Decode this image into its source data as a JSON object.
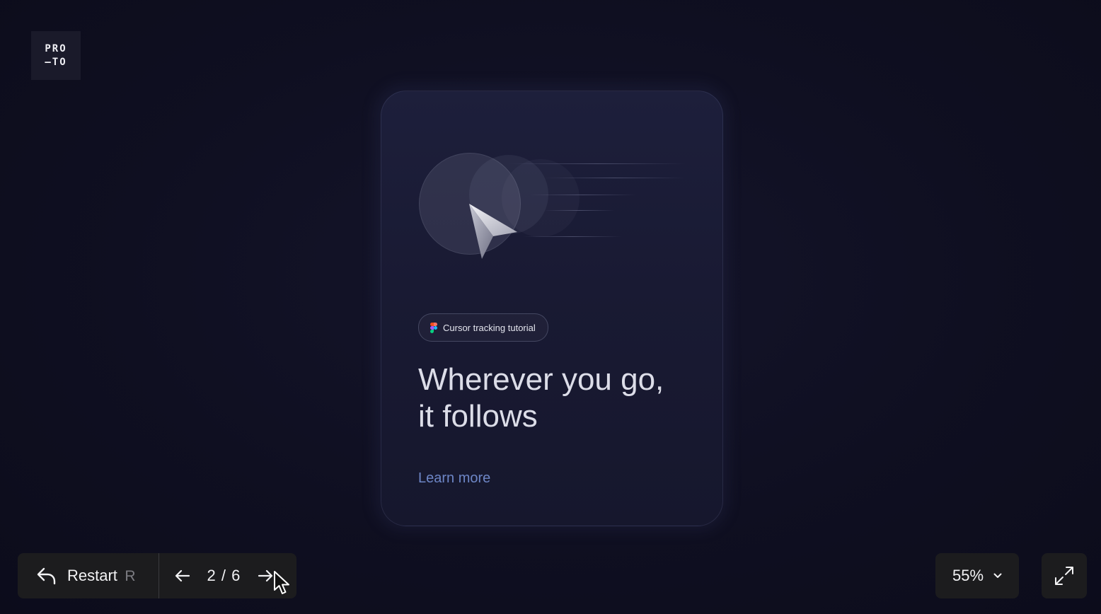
{
  "logo": {
    "line1": "PRO",
    "line2": "—TO"
  },
  "card": {
    "chip_label": "Cursor tracking tutorial",
    "chip_icon": "figma-icon",
    "headline_line1": "Wherever you go,",
    "headline_line2": "it follows",
    "learn_more": "Learn more",
    "illustration_icon": "cursor-pointer-icon"
  },
  "toolbar": {
    "restart_label": "Restart",
    "restart_shortcut": "R",
    "restart_icon": "undo-arrow-icon",
    "prev_icon": "arrow-left-icon",
    "next_icon": "arrow-right-icon",
    "page_indicator": "2 / 6"
  },
  "zoom": {
    "value": "55%",
    "icon": "chevron-down-icon"
  },
  "fullscreen": {
    "icon": "expand-icon"
  },
  "colors": {
    "background": "#0f0f20",
    "card": "#1b1c36",
    "accent_link": "#6d86c6",
    "toolbar": "#1c1c1e"
  }
}
